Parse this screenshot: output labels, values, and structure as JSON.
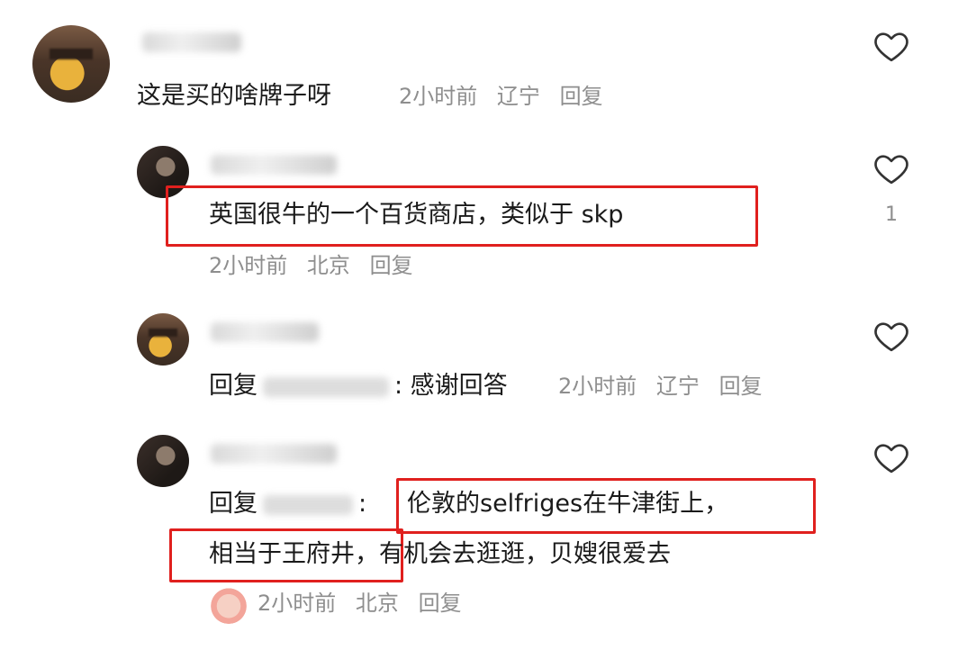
{
  "comments": [
    {
      "text": "这是买的啥牌子呀",
      "time": "2小时前",
      "location": "辽宁",
      "reply_label": "回复",
      "like_count": ""
    },
    {
      "text": "英国很牛的一个百货商店，类似于 skp",
      "time": "2小时前",
      "location": "北京",
      "reply_label": "回复",
      "like_count": "1"
    },
    {
      "reply_prefix": "回复",
      "text": ": 感谢回答",
      "time": "2小时前",
      "location": "辽宁",
      "reply_label": "回复",
      "like_count": ""
    },
    {
      "reply_prefix": "回复",
      "text_line1": "伦敦的selfriges在牛津街上，",
      "text_line2a": "相当于王府井",
      "text_line2b": "，有机会去逛逛，贝嫂很爱去",
      "time": "2小时前",
      "location": "北京",
      "reply_label": "回复",
      "like_count": ""
    }
  ],
  "icons": {
    "like": "heart-outline-icon"
  },
  "colors": {
    "highlight_box": "#e0201e",
    "meta_text": "#8e8e8e"
  }
}
